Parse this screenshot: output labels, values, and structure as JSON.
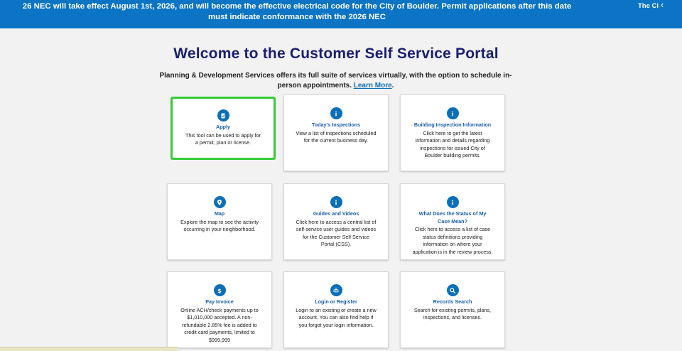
{
  "banner": {
    "text": "26 NEC will take effect August 1st, 2026, and will become the effective electrical code for the City of Boulder. Permit applications after this date must indicate conformance with the 2026 NEC",
    "ticker": "The Ci",
    "prev_icon": "chevron-left-icon"
  },
  "header": {
    "title": "Welcome to the Customer Self Service Portal",
    "intro": "Planning & Development Services offers its full suite of services virtually, with the option to schedule in-person appointments.",
    "learn_more": "Learn More",
    "intro_end": "."
  },
  "cards": [
    {
      "icon": "document-check-icon",
      "title": "Apply",
      "desc": "This tool can be used to apply for a permit, plan or license."
    },
    {
      "icon": "info-icon",
      "title": "Today's Inspections",
      "desc": "View a list of inspections scheduled for the current business day."
    },
    {
      "icon": "info-icon",
      "title": "Building Inspection Information",
      "desc": "Click here to get the latest information and details regarding inspections for issued City of Boulder building permits."
    },
    {
      "icon": "map-pin-icon",
      "title": "Map",
      "desc": "Explore the map to see the activity occurring in your neighborhood."
    },
    {
      "icon": "info-icon",
      "title": "Guides and Videos",
      "desc": "Click here to access a central list of self-service user guides and videos for the Customer Self Service Portal (CSS)."
    },
    {
      "icon": "info-icon",
      "title": "What Does the Status of My Case Mean?",
      "desc": "Click here to access a list of case status definitions providing information on where your application is in the review process."
    },
    {
      "icon": "dollar-icon",
      "title": "Pay Invoice",
      "desc": "Online ACH/check payments up to $1,010,000 accepted. A non-refundable 2.85% fee is added to credit card payments, limited to $999,999"
    },
    {
      "icon": "users-icon",
      "title": "Login or Register",
      "desc": "Login to an existing or create a new account. You can also find help if you forgot your login information."
    },
    {
      "icon": "search-icon",
      "title": "Records Search",
      "desc": "Search for existing permits, plans, inspections, and licenses."
    }
  ],
  "colors": {
    "banner": "#0b74c4",
    "title": "#1b1f6e",
    "accent": "#0b6fb8",
    "selected": "#33cc33"
  }
}
